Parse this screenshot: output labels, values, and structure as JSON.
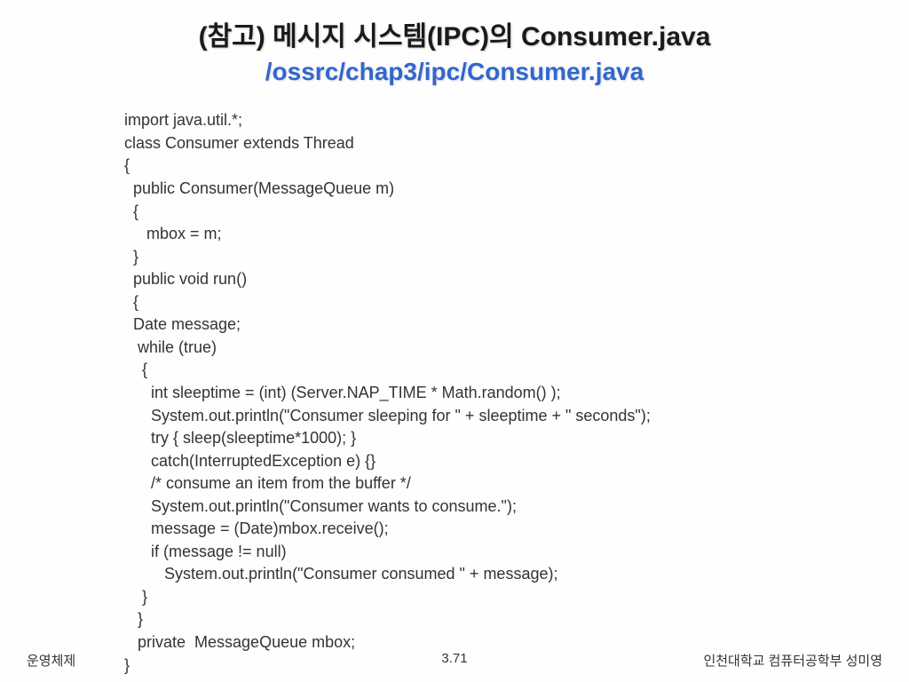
{
  "title": {
    "main": "(참고) 메시지 시스템(IPC)의 Consumer.java",
    "sub": "/ossrc/chap3/ipc/Consumer.java"
  },
  "code": "import java.util.*;\nclass Consumer extends Thread\n{\n  public Consumer(MessageQueue m)\n  {\n     mbox = m;\n  }\n  public void run()\n  {\n  Date message;\n   while (true)\n    {\n      int sleeptime = (int) (Server.NAP_TIME * Math.random() );\n      System.out.println(\"Consumer sleeping for \" + sleeptime + \" seconds\");\n      try { sleep(sleeptime*1000); }\n      catch(InterruptedException e) {}\n      /* consume an item from the buffer */\n      System.out.println(\"Consumer wants to consume.\");\n      message = (Date)mbox.receive();\n      if (message != null)\n         System.out.println(\"Consumer consumed \" + message);\n    }\n   }\n   private  MessageQueue mbox;\n}",
  "footer": {
    "left": "운영체제",
    "center": "3.71",
    "right": "인천대학교 컴퓨터공학부 성미영"
  }
}
